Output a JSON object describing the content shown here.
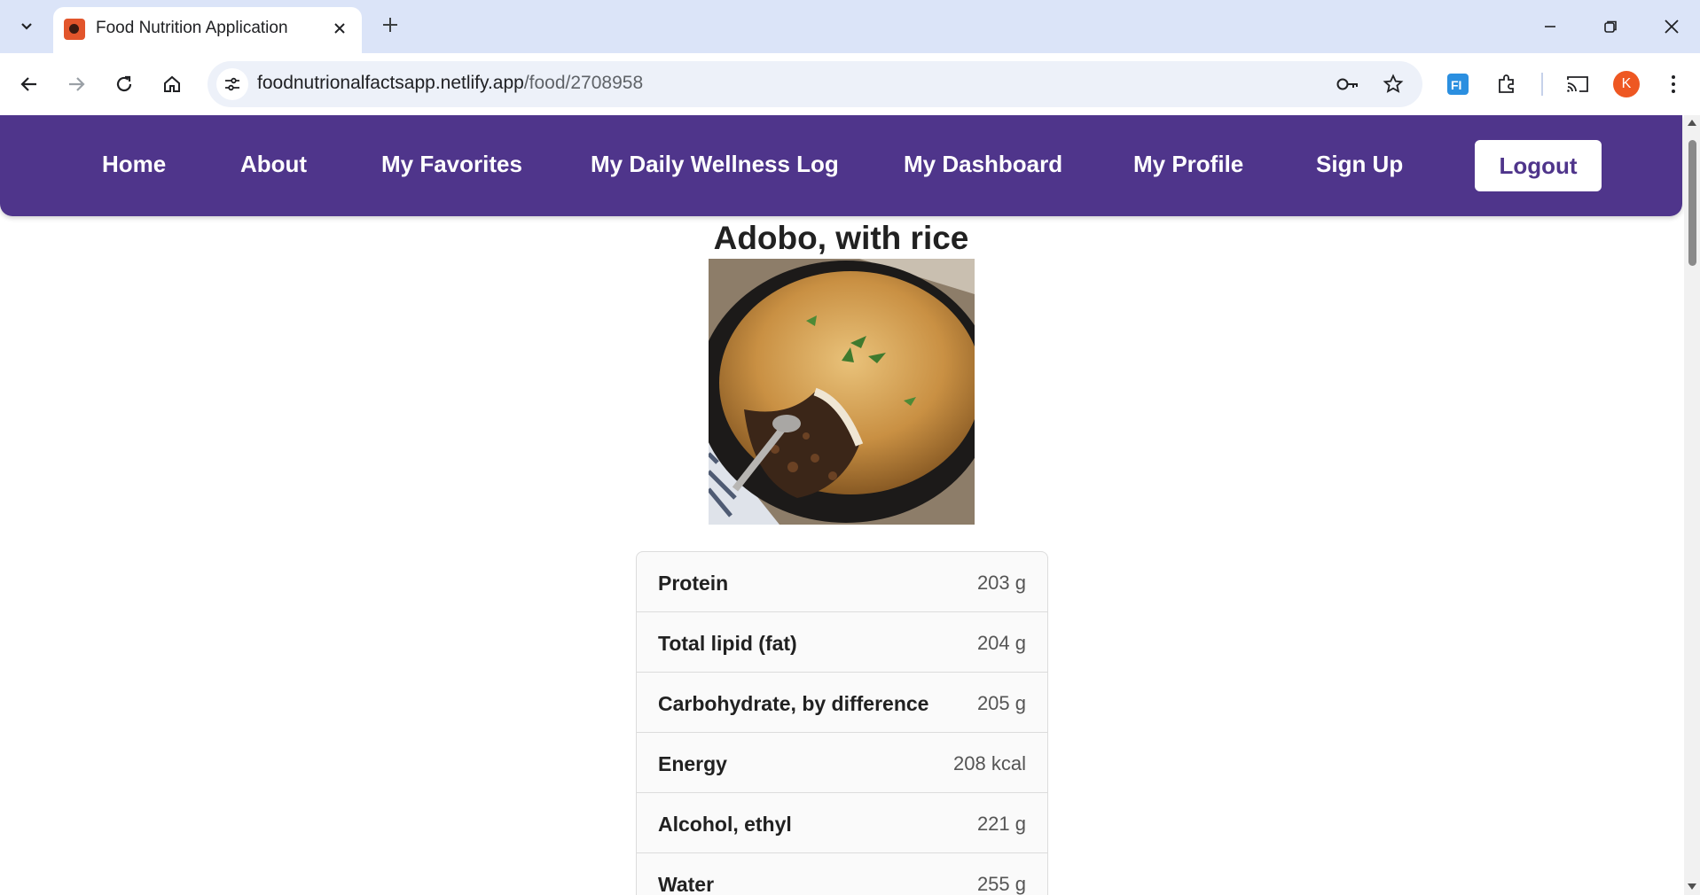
{
  "browser": {
    "tab_title": "Food Nutrition Application",
    "url_host": "foodnutrionalfactsapp.netlify.app",
    "url_path": "/food/2708958",
    "profile_initial": "K",
    "accent_color": "#ee5722"
  },
  "nav": {
    "items": [
      "Home",
      "About",
      "My Favorites",
      "My Daily Wellness Log",
      "My Dashboard",
      "My Profile",
      "Sign Up"
    ],
    "logout_label": "Logout",
    "bar_color": "#4f358b"
  },
  "food": {
    "title": "Adobo, with rice",
    "nutrients": [
      {
        "name": "Protein",
        "value": "203 g"
      },
      {
        "name": "Total lipid (fat)",
        "value": "204 g"
      },
      {
        "name": "Carbohydrate, by difference",
        "value": "205 g"
      },
      {
        "name": "Energy",
        "value": "208 kcal"
      },
      {
        "name": "Alcohol, ethyl",
        "value": "221 g"
      },
      {
        "name": "Water",
        "value": "255 g"
      }
    ]
  }
}
